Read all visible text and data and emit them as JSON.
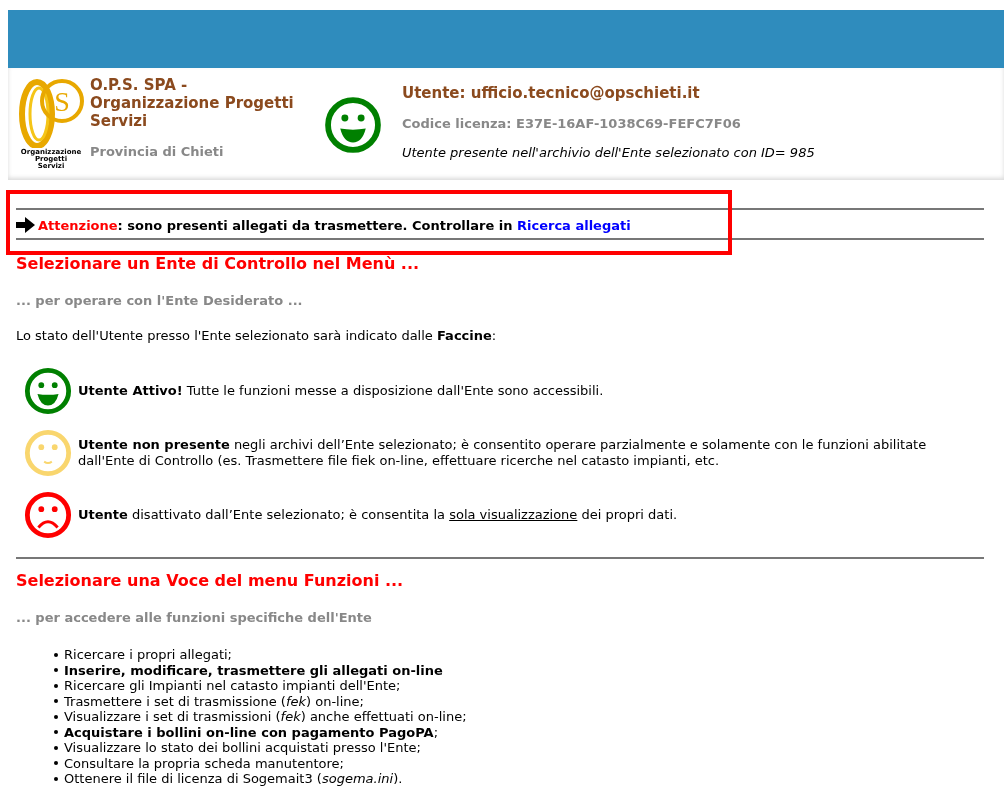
{
  "header": {
    "logo": {
      "letter": "S",
      "caption": [
        "Organizzazione",
        "Progetti",
        "Servizi"
      ]
    },
    "company": "O.P.S. SPA - Organizzazione Progetti Servizi",
    "province": "Provincia di Chieti",
    "user_status": {
      "kind": "happy",
      "color": "#008000"
    },
    "user": "Utente: ufficio.tecnico@opschieti.it",
    "license": "Codice licenza: E37E-16AF-1038C69-FEFC7F06",
    "note": "Utente presente nell'archivio dell'Ente selezionato con ID= 985"
  },
  "notice": {
    "label": "Attenzione",
    "text": ": sono presenti allegati da trasmettere. Controllare in ",
    "link": "Ricerca allegati",
    "highlighted": true
  },
  "section1": {
    "title": "Selezionare un Ente di Controllo nel Menù ...",
    "subtitle": "... per operare con l'Ente Desiderato ...",
    "intro": "Lo stato dell'Utente presso l'Ente selezionato sarà indicato dalle **Faccine**:"
  },
  "faces": [
    {
      "kind": "happy",
      "color": "#008000",
      "text": "**Utente Attivo!** Tutte le funzioni messe a disposizione dall'Ente sono accessibili."
    },
    {
      "kind": "neutral",
      "color": "#f9d66e",
      "text": "**Utente non presente** negli archivi dell’Ente selezionato; è consentito operare parzialmente e solamente con le funzioni abilitate dall'Ente di Controllo (es. Trasmettere file fiek on-line, effettuare ricerche nel catasto impianti, etc."
    },
    {
      "kind": "sad",
      "color": "#ff0000",
      "text": "**Utente** disattivato dall’Ente selezionato; è consentita la ",
      "underlined": "sola visualizzazione",
      "text_after": " dei propri dati."
    }
  ],
  "section2": {
    "title": "Selezionare una Voce del menu Funzioni ...",
    "subtitle": "... per accedere alle funzioni specifiche dell'Ente",
    "items": [
      "Ricercare i propri allegati;",
      "**Inserire, modificare, trasmettere gli allegati on-line**",
      "Ricercare gli Impianti nel catasto impianti dell'Ente;",
      "Trasmettere i set di trasmissione (*fek*) on-line;",
      "Visualizzare i set di trasmissioni (*fek*) anche effettuati on-line;",
      "**Acquistare i bollini on-line con pagamento PagoPA**;",
      "Visualizzare lo stato dei bollini acquistati presso l'Ente;",
      "Consultare la propria scheda manutentore;",
      "Ottenere il file di licenza di Sogemait3 (*sogema.ini*)."
    ]
  }
}
